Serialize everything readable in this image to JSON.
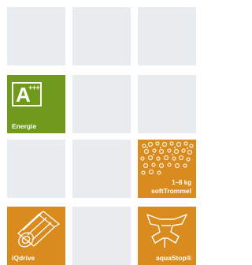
{
  "tiles": {
    "energie": {
      "badge_letter": "A",
      "badge_plus": "+++",
      "label": "Energie",
      "color": "#6f9a1c"
    },
    "softtrommel": {
      "capacity": "1–8 kg",
      "label": "softTrommel",
      "color": "#d98b1e"
    },
    "iqdrive": {
      "label": "iQdrive",
      "color": "#d98b1e"
    },
    "aquastop": {
      "label": "aquaStop®",
      "color": "#d98b1e",
      "footnote": "5"
    }
  },
  "placeholder_color": "#e9ecef",
  "icons": [
    "drum-pattern-icon",
    "motor-icon",
    "faucet-icon"
  ]
}
